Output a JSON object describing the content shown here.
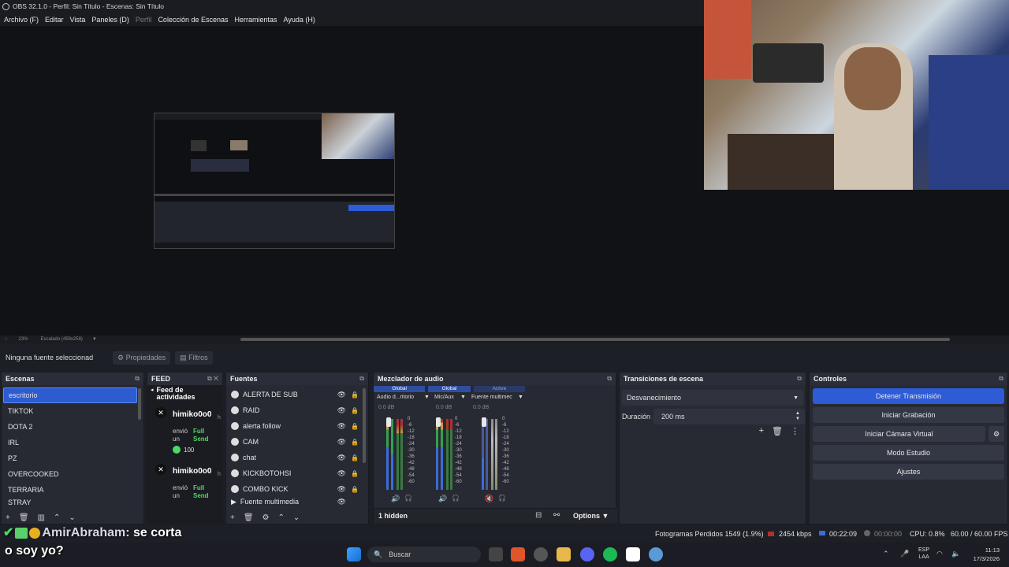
{
  "window": {
    "title": "OBS 32.1.0 - Perfil: Sin Título - Escenas: Sin Título"
  },
  "menu": [
    "Archivo (F)",
    "Editar",
    "Vista",
    "Paneles (D)",
    "Perfil",
    "Colección de Escenas",
    "Herramientas",
    "Ayuda (H)"
  ],
  "preview": {
    "zoom": "23%",
    "scale_label": "Escalado (459x258)"
  },
  "props_bar": {
    "no_selection": "Ninguna fuente seleccionad",
    "properties": "Propiedades",
    "filters": "Filtros"
  },
  "scenes": {
    "title": "Escenas",
    "items": [
      "escritorio",
      "TIKTOK",
      "DOTA 2",
      "IRL",
      "PZ",
      "OVERCOOKED",
      "TERRARIA",
      "STRAY"
    ],
    "selected": "escritorio"
  },
  "feed": {
    "title": "FEED",
    "subtitle": "Feed de actividades",
    "events": [
      {
        "user": "himiko0o0",
        "action": "envió un",
        "highlight": "Full Send",
        "amount": "100",
        "tail": "h"
      },
      {
        "user": "himiko0o0",
        "action": "envió un",
        "highlight": "Full Send",
        "tail": "h"
      }
    ]
  },
  "sources": {
    "title": "Fuentes",
    "items": [
      "ALERTA DE SUB",
      "RAID",
      "alerta follow",
      "CAM",
      "chat",
      "KICKBOTOHSI",
      "COMBO KICK",
      "Fuente multimedia"
    ]
  },
  "mixer": {
    "title": "Mezclador de audio",
    "channels": [
      {
        "tag": "Global",
        "name": "Audio d...ritorio",
        "db": "0.0 dB"
      },
      {
        "tag": "Global",
        "name": "Mic/Aux",
        "db": "0.0 dB"
      },
      {
        "tag": "Active",
        "name": "Fuente multimec",
        "db": "0.0 dB"
      }
    ],
    "scale": [
      "0",
      "-6",
      "-12",
      "-18",
      "-24",
      "-30",
      "-36",
      "-42",
      "-48",
      "-54",
      "-60"
    ],
    "hidden": "1 hidden",
    "options": "Options"
  },
  "transitions": {
    "title": "Transiciones de escena",
    "type": "Desvanecimiento",
    "duration_label": "Duración",
    "duration": "200 ms"
  },
  "controls": {
    "title": "Controles",
    "buttons": [
      "Detener Transmisión",
      "Iniciar Grabación",
      "Iniciar Cámara Virtual",
      "Modo Estudio",
      "Ajustes"
    ]
  },
  "status": {
    "dropped": "Fotogramas Perdidos 1549 (1.9%)",
    "bitrate": "2454 kbps",
    "stream_time": "00:22:09",
    "rec_time": "00:00:00",
    "cpu": "CPU: 0.8%",
    "fps": "60.00 / 60.00 FPS"
  },
  "chat_overlay": {
    "user": "AmirAbraham:",
    "message": "se corta",
    "line2": "o soy yo?"
  },
  "taskbar": {
    "search": "Buscar",
    "lang": "ESP",
    "lang2": "LAA",
    "time": "11:13",
    "date": "17/3/2026"
  }
}
